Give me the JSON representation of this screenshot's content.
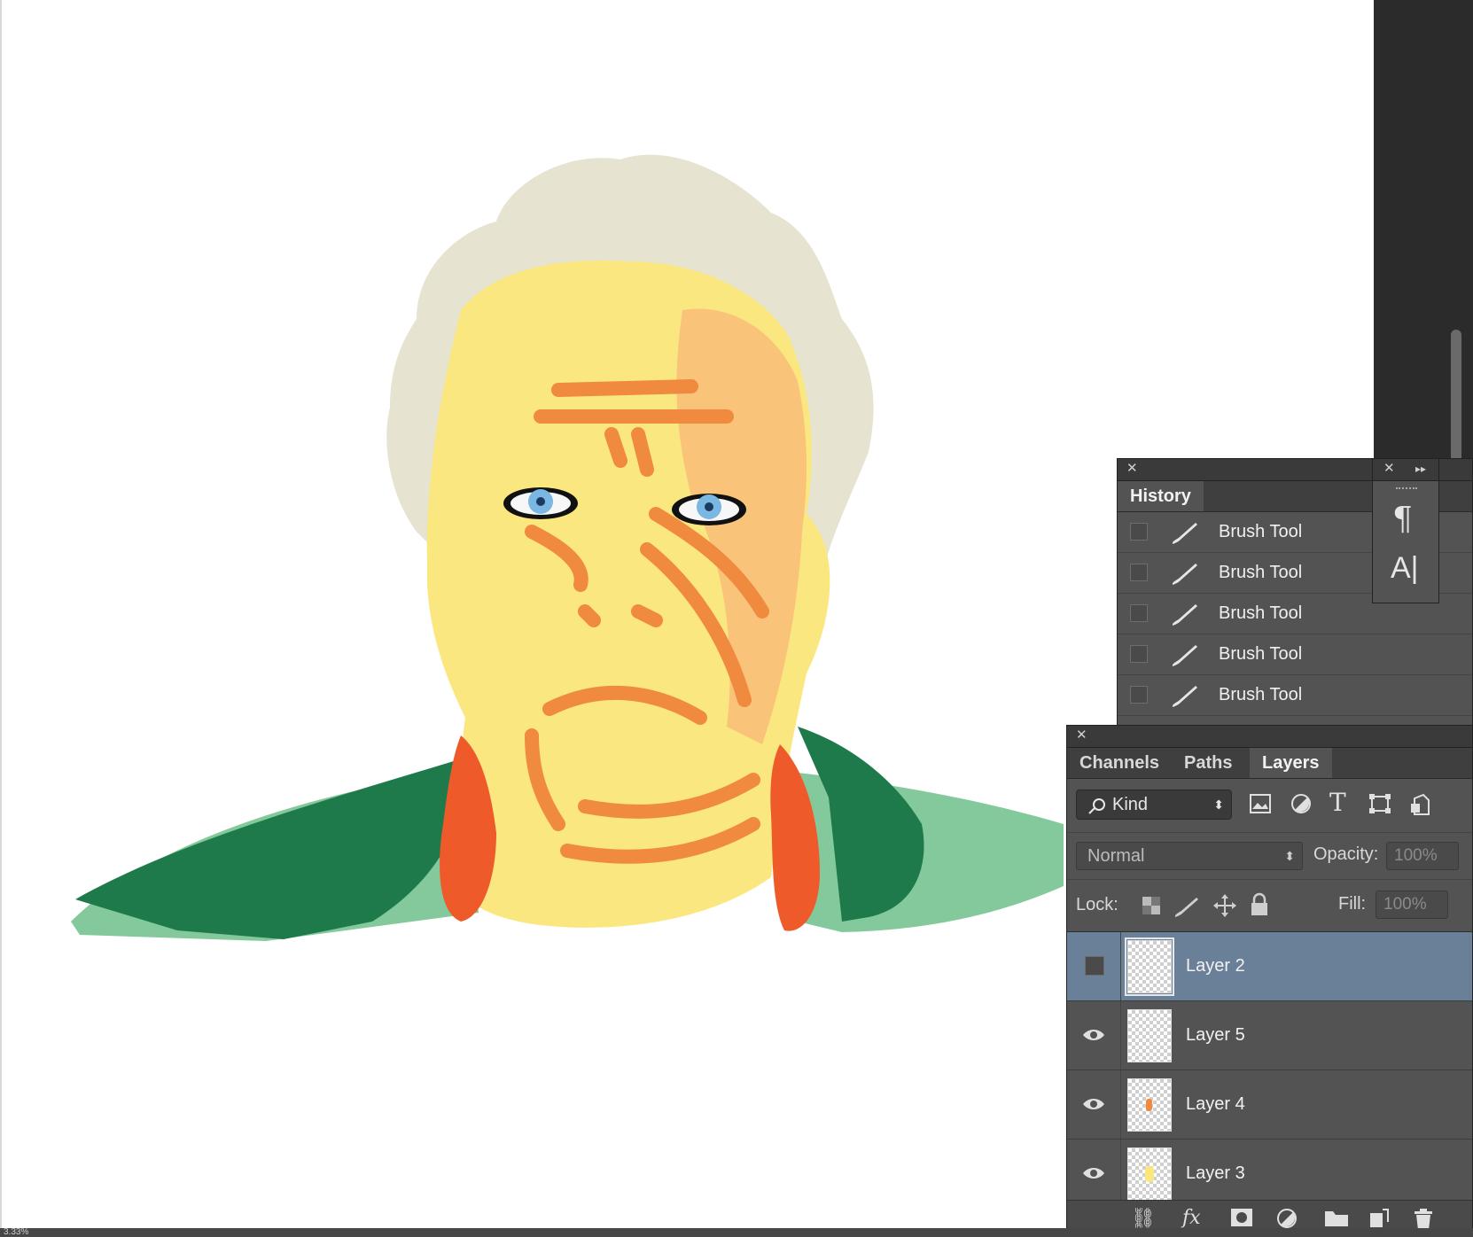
{
  "history": {
    "tab": "History",
    "items": [
      {
        "label": "Brush Tool"
      },
      {
        "label": "Brush Tool"
      },
      {
        "label": "Brush Tool"
      },
      {
        "label": "Brush Tool"
      },
      {
        "label": "Brush Tool"
      }
    ]
  },
  "dock": {
    "pilcrow": "¶",
    "character": "A|"
  },
  "layers": {
    "tabs": [
      "Channels",
      "Paths",
      "Layers"
    ],
    "filter": {
      "kind_label": "Kind"
    },
    "blend_mode": "Normal",
    "opacity_label": "Opacity:",
    "opacity_value": "100%",
    "lock_label": "Lock:",
    "fill_label": "Fill:",
    "fill_value": "100%",
    "items": [
      {
        "name": "Layer 2",
        "visible": false,
        "selected": true
      },
      {
        "name": "Layer 5",
        "visible": true,
        "selected": false
      },
      {
        "name": "Layer 4",
        "visible": true,
        "selected": false
      },
      {
        "name": "Layer 3",
        "visible": true,
        "selected": false
      }
    ]
  },
  "status": {
    "zoom": "3.33%"
  },
  "colors": {
    "panel_bg": "#535353",
    "selected_layer": "#6a7f98",
    "hair": "#e6e3d0",
    "skin": "#fbe780",
    "skin_shadow": "#f9c37a",
    "wrinkle": "#ef8a3e",
    "collar": "#ee5a2a",
    "jacket_dark": "#1e7a4a",
    "jacket_light": "#84c99b"
  }
}
